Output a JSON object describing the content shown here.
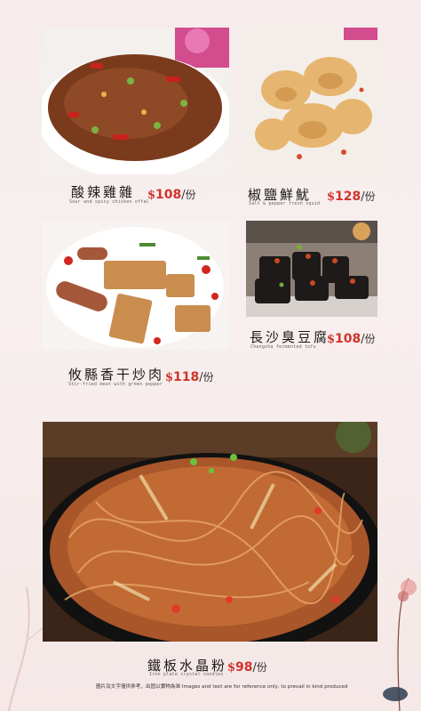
{
  "colors": {
    "background": "#f6ecec",
    "price_red": "#d2322d",
    "text": "#1a1a1a"
  },
  "dishes": [
    {
      "name": "酸辣雞雜",
      "subtitle": "Sour and spicy chicken offal",
      "price_currency": "$",
      "price_amount": "108",
      "price_unit": "份"
    },
    {
      "name": "椒鹽鮮魷",
      "subtitle": "Salt & pepper fresh squid",
      "price_currency": "$",
      "price_amount": "128",
      "price_unit": "份"
    },
    {
      "name": "攸縣香干炒肉",
      "subtitle": "Stir-fried meat with green pepper",
      "price_currency": "$",
      "price_amount": "118",
      "price_unit": "份"
    },
    {
      "name": "長沙臭豆腐",
      "subtitle": "Changsha fermented tofu",
      "price_currency": "$",
      "price_amount": "108",
      "price_unit": "份"
    },
    {
      "name": "鐵板水晶粉",
      "subtitle": "Iron plate crystal noodles",
      "price_currency": "$",
      "price_amount": "98",
      "price_unit": "份"
    }
  ],
  "footer": {
    "note": "圖片及文字僅供參考，出固以實物為准 Images and text are for reference only, to prevail in kind produced"
  }
}
